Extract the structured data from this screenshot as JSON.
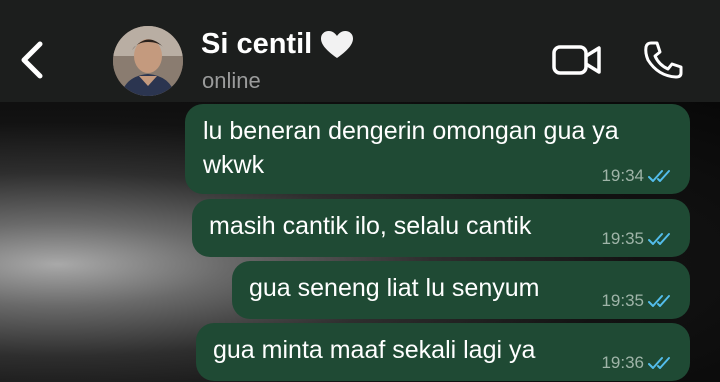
{
  "header": {
    "contact_name": "Si centil",
    "status": "online",
    "colors": {
      "background": "#1c1e1d",
      "icon": "#ffffff",
      "status_text": "#9a9b9b"
    },
    "icons": [
      "chevron-left-icon",
      "white-heart-icon",
      "video-camera-icon",
      "phone-icon"
    ]
  },
  "messages": [
    {
      "lines": [
        "lu beneran dengerin omongan gua ya",
        "wkwk"
      ],
      "time": "19:34",
      "status": "read"
    },
    {
      "lines": [
        "masih cantik ilo, selalu cantik"
      ],
      "time": "19:35",
      "status": "read"
    },
    {
      "lines": [
        "gua seneng liat lu senyum"
      ],
      "time": "19:35",
      "status": "read"
    },
    {
      "lines": [
        "gua minta maaf sekali lagi ya"
      ],
      "time": "19:36",
      "status": "read"
    }
  ],
  "colors": {
    "outgoing_bubble": "#1f4a34",
    "timestamp": "#9fb4a8",
    "read_ticks": "#53bdeb"
  }
}
